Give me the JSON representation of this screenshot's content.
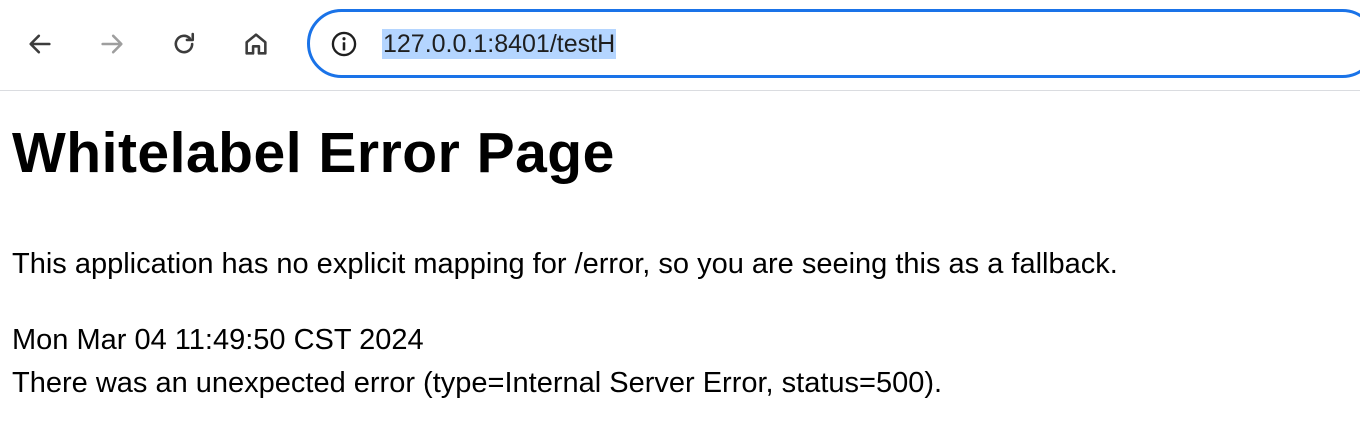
{
  "browser": {
    "nav": {
      "back_icon": "arrow-left-icon",
      "forward_icon": "arrow-right-icon",
      "reload_icon": "reload-icon",
      "home_icon": "home-icon"
    },
    "address_bar": {
      "url": "127.0.0.1:8401/testH",
      "site_info_icon": "info-circle-icon",
      "focus_color": "#1a73e8",
      "selection_color": "#b4d5ff"
    }
  },
  "page": {
    "title": "Whitelabel Error Page",
    "message": "This application has no explicit mapping for /error, so you are seeing this as a fallback.",
    "timestamp": "Mon Mar 04 11:49:50 CST 2024",
    "error_detail": "There was an unexpected error (type=Internal Server Error, status=500)."
  }
}
